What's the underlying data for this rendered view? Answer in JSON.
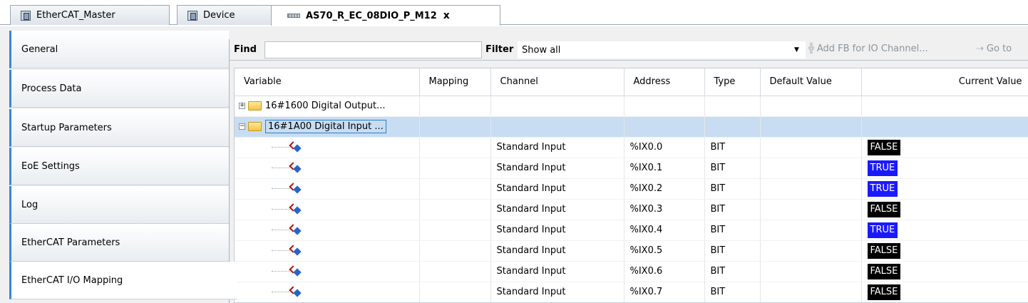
{
  "tabs": [
    {
      "label": "EtherCAT_Master",
      "icon": "device-icon",
      "active": false
    },
    {
      "label": "Device",
      "icon": "device-icon",
      "active": false
    },
    {
      "label": "AS70_R_EC_08DIO_P_M12",
      "icon": "module-icon",
      "active": true
    }
  ],
  "close_glyph": "x",
  "nav": [
    "General",
    "Process Data",
    "Startup Parameters",
    "EoE Settings",
    "Log",
    "EtherCAT Parameters",
    "EtherCAT I/O Mapping"
  ],
  "toolbar": {
    "find_label": "Find",
    "filter_label": "Filter",
    "filter_value": "Show all",
    "add_fb_label": "Add FB for IO Channel...",
    "goto_label": "Go to"
  },
  "columns": [
    "Variable",
    "Mapping",
    "Channel",
    "Address",
    "Type",
    "Default Value",
    "Current Value"
  ],
  "groups": [
    {
      "label": "16#1600 Digital Output...",
      "expanded": false
    },
    {
      "label": "16#1A00 Digital Input ...",
      "expanded": true
    }
  ],
  "rows": [
    {
      "channel": "Standard Input",
      "address": "%IX0.0",
      "type": "BIT",
      "current": "FALSE"
    },
    {
      "channel": "Standard Input",
      "address": "%IX0.1",
      "type": "BIT",
      "current": "TRUE"
    },
    {
      "channel": "Standard Input",
      "address": "%IX0.2",
      "type": "BIT",
      "current": "TRUE"
    },
    {
      "channel": "Standard Input",
      "address": "%IX0.3",
      "type": "BIT",
      "current": "FALSE"
    },
    {
      "channel": "Standard Input",
      "address": "%IX0.4",
      "type": "BIT",
      "current": "TRUE"
    },
    {
      "channel": "Standard Input",
      "address": "%IX0.5",
      "type": "BIT",
      "current": "FALSE"
    },
    {
      "channel": "Standard Input",
      "address": "%IX0.6",
      "type": "BIT",
      "current": "FALSE"
    },
    {
      "channel": "Standard Input",
      "address": "%IX0.7",
      "type": "BIT",
      "current": "FALSE"
    }
  ],
  "colors": {
    "true_bg": "#1a1aff",
    "false_bg": "#000000",
    "selected_row": "#c8ddf2",
    "nav_accent": "#3a86d6"
  }
}
